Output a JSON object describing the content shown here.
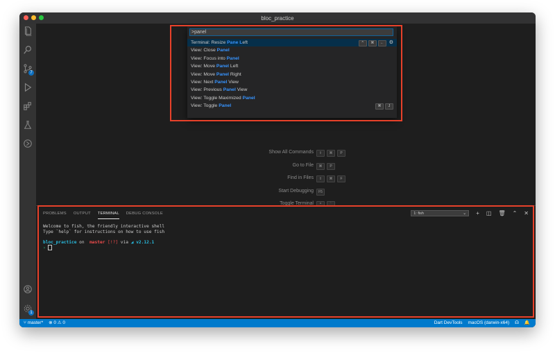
{
  "window": {
    "title": "bloc_practice"
  },
  "activity_bar": {
    "icons": [
      "explorer-icon",
      "search-icon",
      "source-control-icon",
      "run-debug-icon",
      "extensions-icon",
      "testing-icon",
      "dart-devtools-icon",
      "account-icon",
      "manage-gear-icon"
    ],
    "source_control_badge": "7",
    "manage_badge": "1"
  },
  "command_palette": {
    "query": ">panel",
    "items": [
      {
        "prefix": "Terminal: Resize ",
        "match": "Pane",
        "mid": " ",
        "match2": "L",
        "suffix": "eft",
        "keys": [
          "^",
          "⌘",
          "←"
        ]
      },
      {
        "prefix": "View: Close ",
        "match": "Panel",
        "suffix": ""
      },
      {
        "prefix": "View: Focus into ",
        "match": "Panel",
        "suffix": ""
      },
      {
        "prefix": "View: Move ",
        "match": "Panel",
        "suffix": " Left"
      },
      {
        "prefix": "View: Move ",
        "match": "Panel",
        "suffix": " Right"
      },
      {
        "prefix": "View: Next ",
        "match": "Panel",
        "suffix": " View"
      },
      {
        "prefix": "View: Previous ",
        "match": "Panel",
        "suffix": " View"
      },
      {
        "prefix": "View: Toggle Maximized ",
        "match": "Panel",
        "suffix": ""
      },
      {
        "prefix": "View: Toggle ",
        "match": "Panel",
        "suffix": "",
        "keys": [
          "⌘",
          "J"
        ]
      }
    ]
  },
  "watermark": [
    {
      "label": "Show All Commands",
      "keys": [
        "⇧",
        "⌘",
        "P"
      ]
    },
    {
      "label": "Go to File",
      "keys": [
        "⌘",
        "P"
      ]
    },
    {
      "label": "Find in Files",
      "keys": [
        "⇧",
        "⌘",
        "F"
      ]
    },
    {
      "label": "Start Debugging",
      "keys": [
        "F5"
      ]
    },
    {
      "label": "Toggle Terminal",
      "keys": [
        "^",
        "`"
      ]
    }
  ],
  "panel": {
    "tabs": [
      "PROBLEMS",
      "OUTPUT",
      "TERMINAL",
      "DEBUG CONSOLE"
    ],
    "active_tab": "TERMINAL",
    "terminal_selector": "1: fish",
    "terminal_lines": {
      "line1": "Welcome to fish, the friendly interactive shell",
      "line2": "Type `help` for instructions on how to use fish",
      "prompt_dir": "bloc_practice",
      "prompt_on": " on ",
      "prompt_branch_icon": "",
      "prompt_branch": "master",
      "prompt_status": "[!?]",
      "prompt_via": " via ",
      "prompt_dart_icon": "◢",
      "prompt_version": "v2.12.1",
      "prompt_caret": "›"
    }
  },
  "status_bar": {
    "branch": "master*",
    "problems": "⊗ 0 ⚠ 0",
    "dart_devtools": "Dart DevTools",
    "platform": "macOS (darwin-x64)"
  },
  "colors": {
    "accent": "#007acc",
    "highlight_box": "#e8412a",
    "match": "#3794ff"
  }
}
